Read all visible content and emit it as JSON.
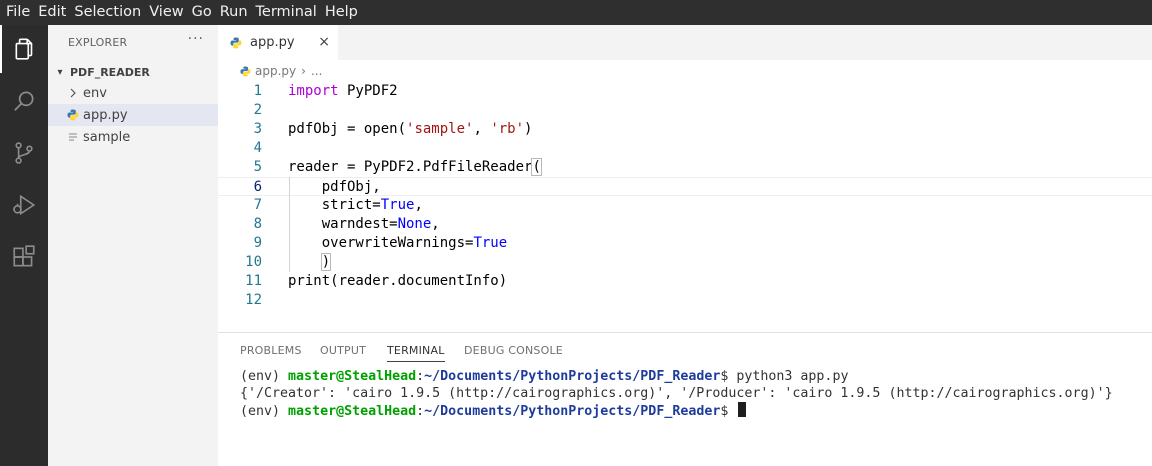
{
  "menu": [
    "File",
    "Edit",
    "Selection",
    "View",
    "Go",
    "Run",
    "Terminal",
    "Help"
  ],
  "activity_bar": {
    "items": [
      "explorer-icon",
      "search-icon",
      "source-control-icon",
      "run-debug-icon",
      "extensions-icon"
    ],
    "active": "explorer-icon"
  },
  "sidebar": {
    "title": "EXPLORER",
    "more": "···",
    "folder": "PDF_READER",
    "items": [
      {
        "label": "env",
        "icon": "chevron-right-icon"
      },
      {
        "label": "app.py",
        "icon": "python-file-icon",
        "selected": true
      },
      {
        "label": "sample",
        "icon": "text-file-icon"
      }
    ]
  },
  "tab": {
    "label": "app.py",
    "close": "×"
  },
  "breadcrumb": {
    "file": "app.py",
    "sep": "›",
    "more": "..."
  },
  "editor": {
    "line_numbers": [
      "1",
      "2",
      "3",
      "4",
      "5",
      "6",
      "7",
      "8",
      "9",
      "10",
      "11",
      "12"
    ],
    "current_line": 6,
    "lines": [
      [
        {
          "t": "import",
          "c": "kw"
        },
        {
          "t": " PyPDF2",
          "c": ""
        }
      ],
      [],
      [
        {
          "t": "pdfObj = open(",
          "c": ""
        },
        {
          "t": "'sample'",
          "c": "str"
        },
        {
          "t": ", ",
          "c": ""
        },
        {
          "t": "'rb'",
          "c": "str"
        },
        {
          "t": ")",
          "c": ""
        }
      ],
      [],
      [
        {
          "t": "reader = PyPDF2.PdfFileReader",
          "c": ""
        },
        {
          "t": "(",
          "c": "bracket"
        }
      ],
      [
        {
          "t": "    pdfObj,",
          "c": ""
        }
      ],
      [
        {
          "t": "    strict=",
          "c": ""
        },
        {
          "t": "True",
          "c": "const"
        },
        {
          "t": ",",
          "c": ""
        }
      ],
      [
        {
          "t": "    warndest=",
          "c": ""
        },
        {
          "t": "None",
          "c": "const"
        },
        {
          "t": ",",
          "c": ""
        }
      ],
      [
        {
          "t": "    overwriteWarnings=",
          "c": ""
        },
        {
          "t": "True",
          "c": "const"
        }
      ],
      [
        {
          "t": "    ",
          "c": ""
        },
        {
          "t": ")",
          "c": "bracket"
        }
      ],
      [
        {
          "t": "print(reader.documentInfo)",
          "c": ""
        }
      ],
      []
    ]
  },
  "panel": {
    "tabs": [
      "PROBLEMS",
      "OUTPUT",
      "TERMINAL",
      "DEBUG CONSOLE"
    ],
    "active_tab": "TERMINAL",
    "terminal": {
      "line1": {
        "env": "(env) ",
        "user": "master@StealHead",
        "colon": ":",
        "path": "~/Documents/PythonProjects/PDF_Reader",
        "prompt": "$ ",
        "command": "python3 app.py"
      },
      "line2": "{'/Creator': 'cairo 1.9.5 (http://cairographics.org)', '/Producer': 'cairo 1.9.5 (http://cairographics.org)'}",
      "line3": {
        "env": "(env) ",
        "user": "master@StealHead",
        "colon": ":",
        "path": "~/Documents/PythonProjects/PDF_Reader",
        "prompt": "$ "
      }
    }
  },
  "colors": {
    "menubar": "#2f2f2f",
    "activitybar": "#2c2c2c",
    "sidebar": "#f3f3f3",
    "selected_item": "#e4e6f1",
    "keyword": "#af00db",
    "string": "#a31515",
    "constant": "#0000ff",
    "line_number": "#237893",
    "terminal_user": "#00a100",
    "terminal_path": "#1f3c9c"
  }
}
